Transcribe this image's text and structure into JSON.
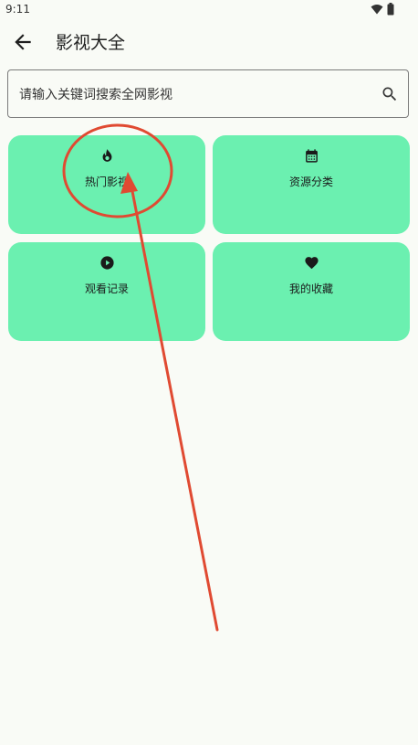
{
  "status": {
    "time": "9:11"
  },
  "header": {
    "title": "影视大全"
  },
  "search": {
    "placeholder": "请输入关键词搜索全网影视"
  },
  "tiles": [
    {
      "label": "热门影视",
      "icon": "flame-icon"
    },
    {
      "label": "资源分类",
      "icon": "calendar-icon"
    },
    {
      "label": "观看记录",
      "icon": "play-circle-icon"
    },
    {
      "label": "我的收藏",
      "icon": "heart-icon"
    }
  ],
  "colors": {
    "background": "#f9fbf6",
    "tile": "#6bf0b0",
    "annotation": "#e04a32"
  }
}
